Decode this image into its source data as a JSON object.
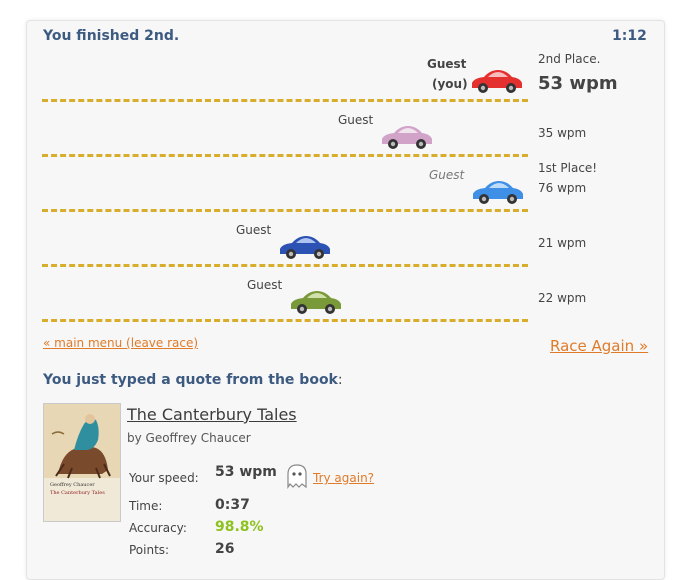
{
  "header": {
    "finish_text": "You finished 2nd.",
    "timer": "1:12"
  },
  "racers": [
    {
      "name": "Guest",
      "you_label": "(you)",
      "place": "2nd Place.",
      "wpm": "53 wpm",
      "car_color": "#e53030"
    },
    {
      "name": "Guest",
      "place": "",
      "wpm": "35 wpm",
      "car_color": "#d2a3c8"
    },
    {
      "name": "Guest",
      "place": "1st Place!",
      "wpm": "76 wpm",
      "car_color": "#3f8fe6"
    },
    {
      "name": "Guest",
      "place": "",
      "wpm": "21 wpm",
      "car_color": "#2c52b3"
    },
    {
      "name": "Guest",
      "place": "",
      "wpm": "22 wpm",
      "car_color": "#7a9a3a"
    }
  ],
  "nav": {
    "main_menu": "« main menu (leave race)",
    "race_again": "Race Again »"
  },
  "quote": {
    "heading_bold": "You just typed a quote from the book",
    "heading_colon": ":",
    "book_title": "The Canterbury Tales",
    "book_author": "by Geoffrey Chaucer",
    "cover": {
      "author": "Geoffrey Chaucer",
      "title": "The Canterbury Tales"
    }
  },
  "results": {
    "speed_label": "Your speed:",
    "speed_value": "53 wpm",
    "try_again": "Try again?",
    "time_label": "Time:",
    "time_value": "0:37",
    "accuracy_label": "Accuracy:",
    "accuracy_value": "98.8%",
    "points_label": "Points:",
    "points_value": "26"
  },
  "colors": {
    "accent_link": "#e07b2a",
    "heading": "#3d5a80",
    "track": "#d9ad2c",
    "accuracy": "#8dc21f"
  }
}
